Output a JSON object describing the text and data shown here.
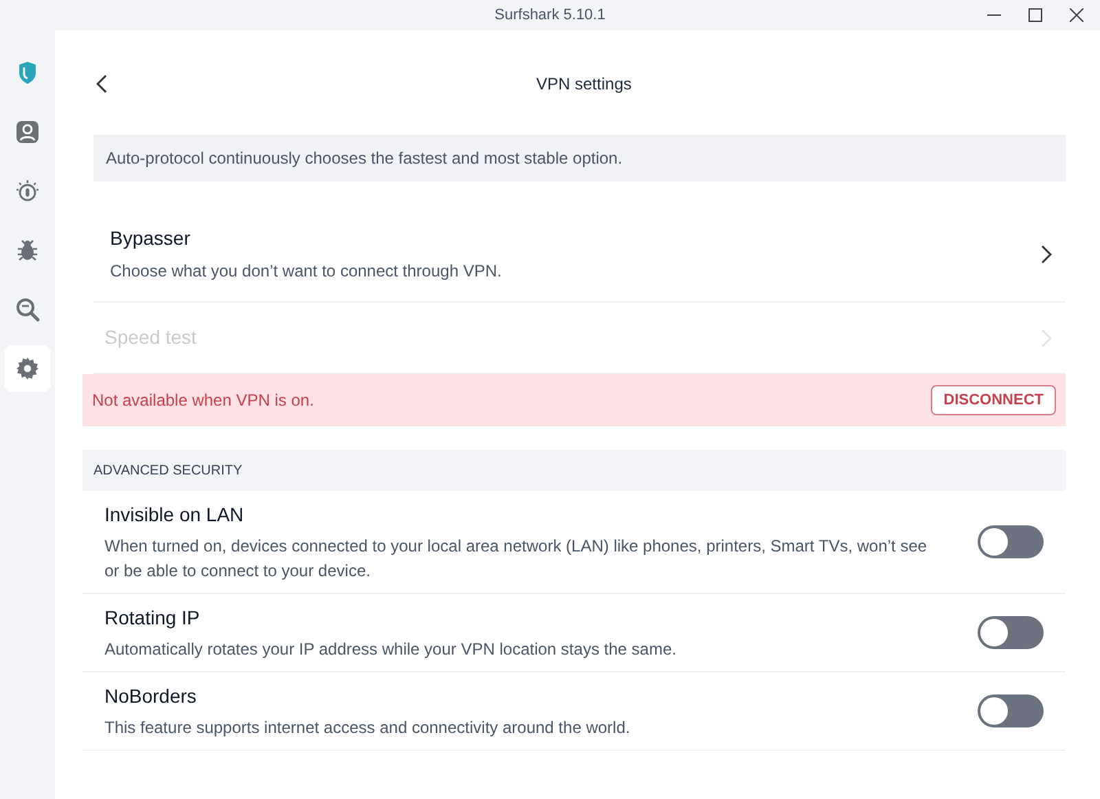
{
  "window": {
    "title": "Surfshark 5.10.1"
  },
  "sidebar": {
    "items": [
      {
        "kind": "shield",
        "selected": false
      },
      {
        "kind": "person",
        "selected": false
      },
      {
        "kind": "alert",
        "selected": false
      },
      {
        "kind": "bug",
        "selected": false
      },
      {
        "kind": "search",
        "selected": false
      },
      {
        "kind": "settings",
        "selected": true
      }
    ]
  },
  "page": {
    "title": "VPN settings"
  },
  "protocol_note": "Auto-protocol continuously chooses the fastest and most stable option.",
  "nav_rows": [
    {
      "title": "Bypasser",
      "description": "Choose what you don’t want to connect through VPN.",
      "disabled": false
    },
    {
      "title": "Speed test",
      "disabled": true
    }
  ],
  "warning": {
    "message": "Not available when VPN is on.",
    "button": "DISCONNECT"
  },
  "advanced_security": {
    "heading": "ADVANCED SECURITY",
    "toggles": [
      {
        "title": "Invisible on LAN",
        "description": "When turned on, devices connected to your local area network (LAN) like phones, printers, Smart TVs, won’t see or be able to connect to your device.",
        "on": false
      },
      {
        "title": "Rotating IP",
        "description": "Automatically rotates your IP address while your VPN location stays the same.",
        "on": false
      },
      {
        "title": "NoBorders",
        "description": "This feature supports internet access and connectivity around the world.",
        "on": false
      }
    ]
  }
}
